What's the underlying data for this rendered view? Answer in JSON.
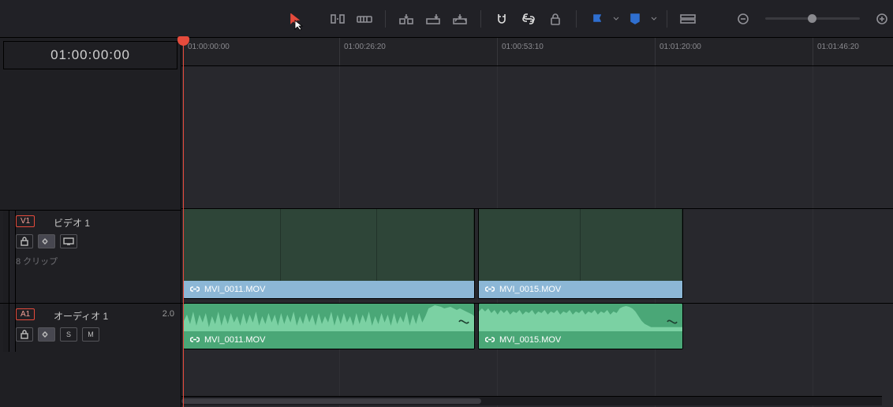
{
  "toolbar": {
    "tools": {
      "selection": "selection-tool",
      "blade": "blade-tool",
      "insert": "insert-tool",
      "overwrite": "overwrite-tool",
      "replace": "replace-tool",
      "ripple": "ripple-tool",
      "snap": "snap-toggle",
      "link": "link-toggle",
      "lock": "lock-toggle"
    },
    "marker_color_blue": "#3f7fe0",
    "flag_color_blue": "#3f7fe0"
  },
  "timecode": "01:00:00:00",
  "ruler": {
    "ticks": [
      "01:00:00:00",
      "01:00:26:20",
      "01:00:53:10",
      "01:01:20:00",
      "01:01:46:20"
    ]
  },
  "video_track": {
    "dest": "V1",
    "name": "ビデオ 1",
    "clip_count_label": "8 クリップ"
  },
  "audio_track": {
    "dest": "A1",
    "name": "オーディオ 1",
    "channels": "2.0",
    "buttons": {
      "s": "S",
      "m": "M"
    }
  },
  "clips": {
    "v1": {
      "filename": "MVI_0011.MOV"
    },
    "v2": {
      "filename": "MVI_0015.MOV"
    },
    "a1": {
      "filename": "MVI_0011.MOV"
    },
    "a2": {
      "filename": "MVI_0015.MOV"
    }
  }
}
